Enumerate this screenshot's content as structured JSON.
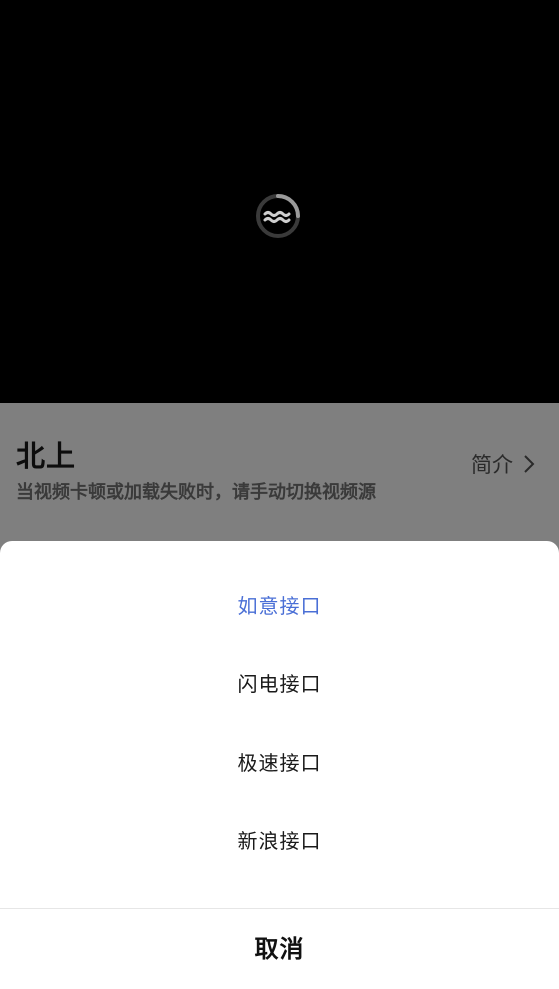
{
  "player": {
    "loading_icon": "loading-spinner-icon"
  },
  "info": {
    "title": "北上",
    "notice": "当视频卡顿或加载失败时，请手动切换视频源",
    "intro_link": "简介",
    "intro_chevron_icon": "chevron-right-icon"
  },
  "source_sheet": {
    "options": [
      {
        "label": "如意接口",
        "selected": true
      },
      {
        "label": "闪电接口",
        "selected": false
      },
      {
        "label": "极速接口",
        "selected": false
      },
      {
        "label": "新浪接口",
        "selected": false
      }
    ],
    "cancel_label": "取消",
    "selected_color": "#4a6fd6"
  }
}
